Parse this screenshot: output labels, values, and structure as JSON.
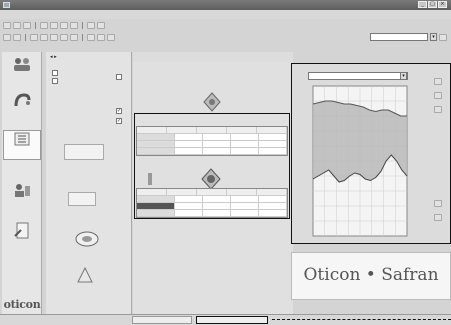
{
  "window": {
    "title": "",
    "controls": [
      "_",
      "□",
      "×"
    ]
  },
  "menu": {
    "items": [
      "",
      "",
      "",
      "",
      "",
      "",
      ""
    ]
  },
  "toolbar": {
    "instrument_combo": ""
  },
  "sidebar": {
    "brand": "oticon",
    "items": [
      {
        "label": ""
      },
      {
        "label": ""
      },
      {
        "label": "",
        "selected": true
      },
      {
        "label": ""
      },
      {
        "label": ""
      }
    ]
  },
  "options_panel": {
    "sections": [
      {
        "title": ""
      },
      {
        "title": ""
      },
      {
        "title": ""
      },
      {
        "title": ""
      },
      {
        "title": ""
      },
      {
        "title": ""
      }
    ]
  },
  "main": {
    "breadcrumb": "",
    "table1": {
      "rows": [
        [
          "",
          "",
          "",
          "",
          ""
        ],
        [
          "",
          "",
          "",
          "",
          ""
        ],
        [
          "",
          "",
          "",
          "",
          ""
        ],
        [
          "",
          "",
          "",
          "",
          ""
        ]
      ]
    },
    "table2": {
      "rows": [
        [
          "",
          "",
          "",
          "",
          ""
        ],
        [
          "",
          "",
          "",
          "",
          ""
        ],
        [
          "",
          "",
          "",
          "",
          ""
        ],
        [
          "",
          "",
          "",
          "",
          ""
        ]
      ]
    }
  },
  "curve_panel": {
    "view_select": "",
    "x_ticks": [],
    "y_ticks": [],
    "threshold_curve": [
      0.62,
      0.6,
      0.58,
      0.56,
      0.6,
      0.64,
      0.63,
      0.6,
      0.58,
      0.59,
      0.62,
      0.63,
      0.61,
      0.57,
      0.5,
      0.46,
      0.5,
      0.56,
      0.6
    ],
    "uncomfortable_curve": [
      0.12,
      0.11,
      0.1,
      0.1,
      0.11,
      0.12,
      0.12,
      0.13,
      0.14,
      0.16,
      0.17,
      0.16,
      0.16,
      0.18,
      0.2,
      0.2
    ]
  },
  "brand_panel": {
    "text": "Oticon • Safran"
  },
  "status": {
    "buttons": [
      "",
      ""
    ]
  }
}
